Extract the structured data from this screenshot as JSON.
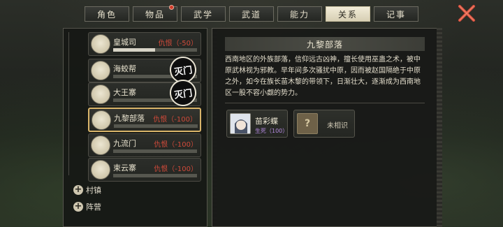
{
  "tabs": [
    {
      "label": "角色",
      "active": false,
      "badge": false
    },
    {
      "label": "物品",
      "active": false,
      "badge": true
    },
    {
      "label": "武学",
      "active": false,
      "badge": false
    },
    {
      "label": "武道",
      "active": false,
      "badge": false
    },
    {
      "label": "能力",
      "active": false,
      "badge": false
    },
    {
      "label": "关系",
      "active": true,
      "badge": false
    },
    {
      "label": "记事",
      "active": false,
      "badge": false
    }
  ],
  "factions": [
    {
      "name": "皇城司",
      "status": "仇恨（-50）",
      "bar_fraction": 0.5,
      "seal": ""
    },
    {
      "name": "海蛟帮",
      "status": "",
      "bar_fraction": 0.0,
      "seal": "灭门"
    },
    {
      "name": "大王寨",
      "status": "",
      "bar_fraction": 0.0,
      "seal": "灭门"
    },
    {
      "name": "九黎部落",
      "status": "仇恨（-100）",
      "bar_fraction": 0.0,
      "seal": "",
      "selected": true
    },
    {
      "name": "九流门",
      "status": "仇恨（-100）",
      "bar_fraction": 0.0,
      "seal": ""
    },
    {
      "name": "束云寨",
      "status": "仇恨（-100）",
      "bar_fraction": 0.0,
      "seal": ""
    }
  ],
  "categories": [
    {
      "label": "村镇"
    },
    {
      "label": "阵营"
    }
  ],
  "detail": {
    "title": "九黎部落",
    "description": "西南地区的外族部落，信仰远古凶神，擅长使用巫蛊之术，被中原武林视为邪教。早年间多次骚扰中原，因而被赵国隔绝于中原之外，如今在族长苗木黎的带领下，日渐壮大，逐渐成为西南地区一股不容小觑的势力。",
    "members": [
      {
        "name": "苗彩蝶",
        "status": "生死（100）"
      },
      {
        "name": "未相识",
        "unknown_glyph": "?"
      }
    ]
  },
  "colors": {
    "hostile": "#cf4a3a",
    "selected_border": "#d9b56a",
    "close_x": "#d9503e"
  }
}
